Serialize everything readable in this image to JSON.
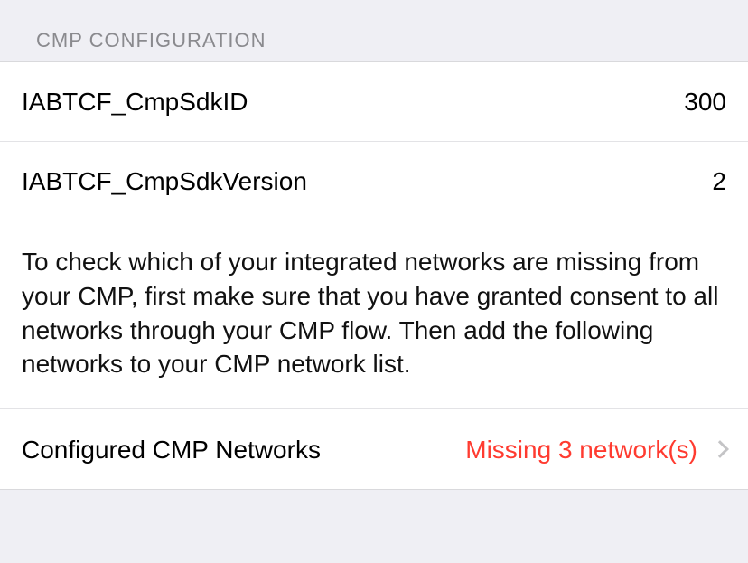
{
  "section": {
    "header": "CMP Configuration"
  },
  "rows": {
    "sdkId": {
      "label": "IABTCF_CmpSdkID",
      "value": "300"
    },
    "sdkVersion": {
      "label": "IABTCF_CmpSdkVersion",
      "value": "2"
    },
    "description": "To check which of your integrated networks are missing from your CMP, first make sure that you have granted consent to all networks through your CMP flow. Then add the following networks to your CMP network list.",
    "networks": {
      "label": "Configured CMP Networks",
      "status": "Missing 3 network(s)"
    }
  }
}
